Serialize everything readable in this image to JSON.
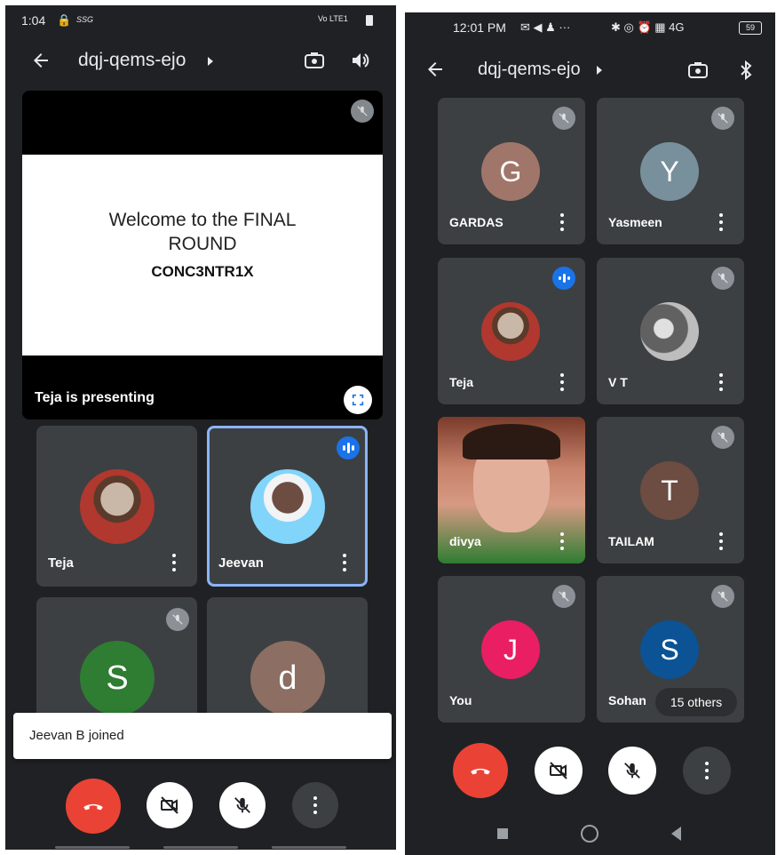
{
  "left": {
    "status": {
      "time": "1:04",
      "lock": "🔒",
      "extra": "SSG",
      "right": "Vo LTE1"
    },
    "header": {
      "meeting_code": "dqj-qems-ejo"
    },
    "presentation": {
      "line1": "Welcome to the FINAL",
      "line2": "ROUND",
      "line3": "CONC3NTR1X",
      "caption": "Teja is presenting"
    },
    "tiles": [
      {
        "name": "Teja"
      },
      {
        "name": "Jeevan"
      },
      {
        "initial": "S",
        "color": "#2e7d32"
      },
      {
        "initial": "d",
        "color": "#8d6e63"
      }
    ],
    "toast": "Jeevan B joined"
  },
  "right": {
    "status": {
      "time": "12:01 PM",
      "icons": "✉ ◀ ♟ ···",
      "right_icons": "✱ ◎ ⏰ ▦ 4G",
      "battery": "59"
    },
    "header": {
      "meeting_code": "dqj-qems-ejo"
    },
    "tiles": [
      {
        "name": "GARDAS",
        "initial": "G",
        "color": "#a1766a"
      },
      {
        "name": "Yasmeen",
        "initial": "Y",
        "color": "#78909c"
      },
      {
        "name": "Teja"
      },
      {
        "name": "V T"
      },
      {
        "name": "divya"
      },
      {
        "name": "TAILAM",
        "initial": "T",
        "color": "#6d4c41"
      },
      {
        "name": "You",
        "initial": "J",
        "color": "#e91e63"
      },
      {
        "name": "Sohan",
        "initial": "S",
        "color": "#0b5394"
      }
    ],
    "others_badge": "15 others"
  },
  "colors": {
    "end_call": "#ea4335",
    "speaking": "#1a73e8",
    "bg": "#202124",
    "tile": "#3c4043"
  }
}
